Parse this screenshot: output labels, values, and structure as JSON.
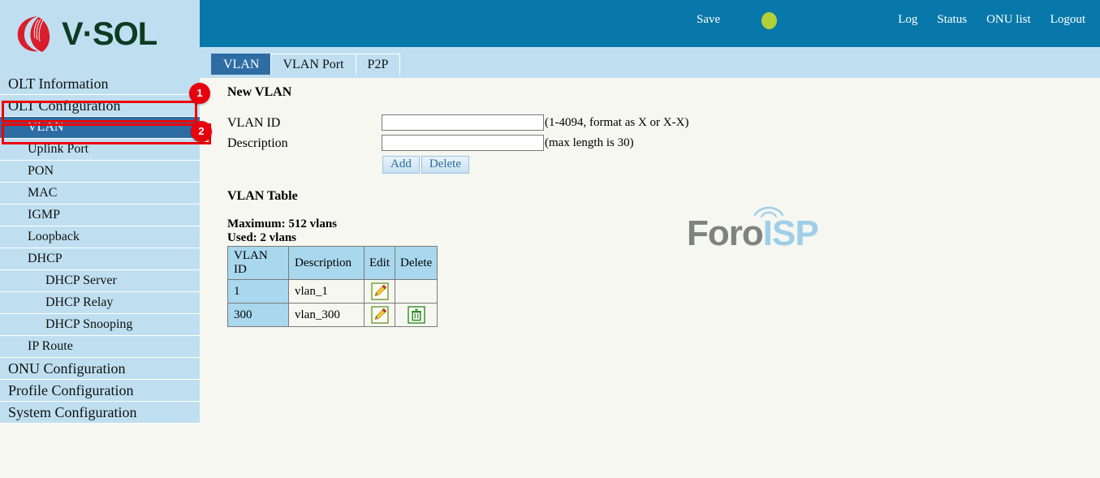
{
  "brand": {
    "name": "V·SOL",
    "logo_icon": "vsol-flame-logo",
    "mark_color": "#d81e2c",
    "text_color": "#0c3b22"
  },
  "header": {
    "save_label": "Save",
    "status_dot": {
      "icon": "status-indicator-dot",
      "color": "#b3d039"
    },
    "links": [
      {
        "label": "Log",
        "name": "log"
      },
      {
        "label": "Status",
        "name": "status"
      },
      {
        "label": "ONU list",
        "name": "onu-list"
      },
      {
        "label": "Logout",
        "name": "logout"
      }
    ]
  },
  "sidebar": {
    "items": [
      {
        "label": "OLT Information",
        "level": 0,
        "active": false
      },
      {
        "label": "OLT Configuration",
        "level": 0,
        "active": false
      },
      {
        "label": "VLAN",
        "level": 1,
        "active": true
      },
      {
        "label": "Uplink Port",
        "level": 1,
        "active": false
      },
      {
        "label": "PON",
        "level": 1,
        "active": false
      },
      {
        "label": "MAC",
        "level": 1,
        "active": false
      },
      {
        "label": "IGMP",
        "level": 1,
        "active": false
      },
      {
        "label": "Loopback",
        "level": 1,
        "active": false
      },
      {
        "label": "DHCP",
        "level": 1,
        "active": false
      },
      {
        "label": "DHCP Server",
        "level": 2,
        "active": false
      },
      {
        "label": "DHCP Relay",
        "level": 2,
        "active": false
      },
      {
        "label": "DHCP Snooping",
        "level": 2,
        "active": false
      },
      {
        "label": "IP Route",
        "level": 1,
        "active": false
      },
      {
        "label": "ONU Configuration",
        "level": 0,
        "active": false
      },
      {
        "label": "Profile Configuration",
        "level": 0,
        "active": false
      },
      {
        "label": "System Configuration",
        "level": 0,
        "active": false
      }
    ]
  },
  "annotations": [
    {
      "number": "1",
      "target": "OLT Configuration"
    },
    {
      "number": "2",
      "target": "VLAN"
    }
  ],
  "tabs": [
    {
      "label": "VLAN",
      "active": true
    },
    {
      "label": "VLAN Port",
      "active": false
    },
    {
      "label": "P2P",
      "active": false
    }
  ],
  "new_vlan": {
    "title": "New VLAN",
    "fields": [
      {
        "label": "VLAN ID",
        "value": "",
        "placeholder": "",
        "hint": "(1-4094, format as X or X-X)"
      },
      {
        "label": "Description",
        "value": "",
        "placeholder": "",
        "hint": "(max length is 30)"
      }
    ],
    "buttons": [
      {
        "label": "Add"
      },
      {
        "label": "Delete"
      }
    ]
  },
  "vlan_table": {
    "title": "VLAN Table",
    "maximum_text": "Maximum: 512 vlans",
    "used_text": "Used: 2 vlans",
    "columns": [
      "VLAN ID",
      "Description",
      "Edit",
      "Delete"
    ],
    "rows": [
      {
        "vlan_id": "1",
        "description": "vlan_1",
        "edit_icon": "edit-pencil-icon",
        "delete_icon": ""
      },
      {
        "vlan_id": "300",
        "description": "vlan_300",
        "edit_icon": "edit-pencil-icon",
        "delete_icon": "delete-trash-icon"
      }
    ]
  },
  "watermark": {
    "part1": "Foro",
    "part2": "ISP"
  }
}
